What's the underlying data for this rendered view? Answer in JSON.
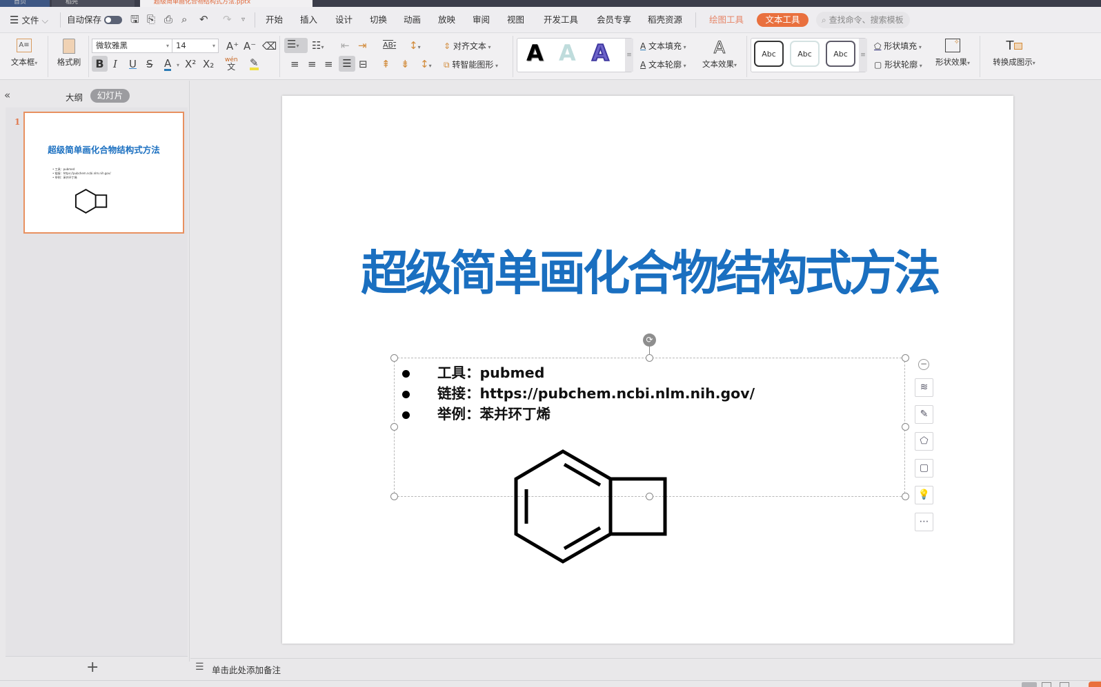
{
  "window_tabs": [
    {
      "label": "首页"
    },
    {
      "label": "稻壳"
    },
    {
      "label": "超级简单画化合物结构式方法.pptx"
    }
  ],
  "menubar": {
    "file_label": "文件",
    "autosave_label": "自动保存",
    "autosave_on": false,
    "tabs": [
      "开始",
      "插入",
      "设计",
      "切换",
      "动画",
      "放映",
      "审阅",
      "视图",
      "开发工具",
      "会员专享",
      "稻壳资源"
    ],
    "drawing_tools_label": "绘图工具",
    "text_tools_label": "文本工具",
    "search_placeholder": "查找命令、搜索模板"
  },
  "ribbon": {
    "textbox_label": "文本框",
    "format_painter_label": "格式刷",
    "font_name": "微软雅黑",
    "font_size": "14",
    "align_text_label": "对齐文本",
    "smartart_label": "转智能图形",
    "text_fill_label": "文本填充",
    "text_outline_label": "文本轮廓",
    "text_effect_label": "文本效果",
    "style_glyph": "A",
    "shape_style_sample": "Abc",
    "shape_fill_label": "形状填充",
    "shape_outline_label": "形状轮廓",
    "shape_effect_label": "形状效果",
    "convert_diagram_label": "转换成图示",
    "phonetic_label": "wén",
    "bold": "B",
    "italic": "I",
    "underline": "U",
    "strike": "S",
    "fontcolor": "A",
    "superscript": "X²",
    "subscript": "X₂"
  },
  "left_panel": {
    "tab_outline": "大纲",
    "tab_slides": "幻灯片",
    "slide_number": "1",
    "add_slide": "+"
  },
  "slide": {
    "title": "超级简单画化合物结构式方法",
    "bullets": [
      "工具：pubmed",
      "链接：https://pubchem.ncbi.nlm.nih.gov/",
      "举例：苯并环丁烯"
    ],
    "title_color": "#1a6fc0"
  },
  "notes_placeholder": "单击此处添加备注",
  "accent_color": "#e9703e"
}
